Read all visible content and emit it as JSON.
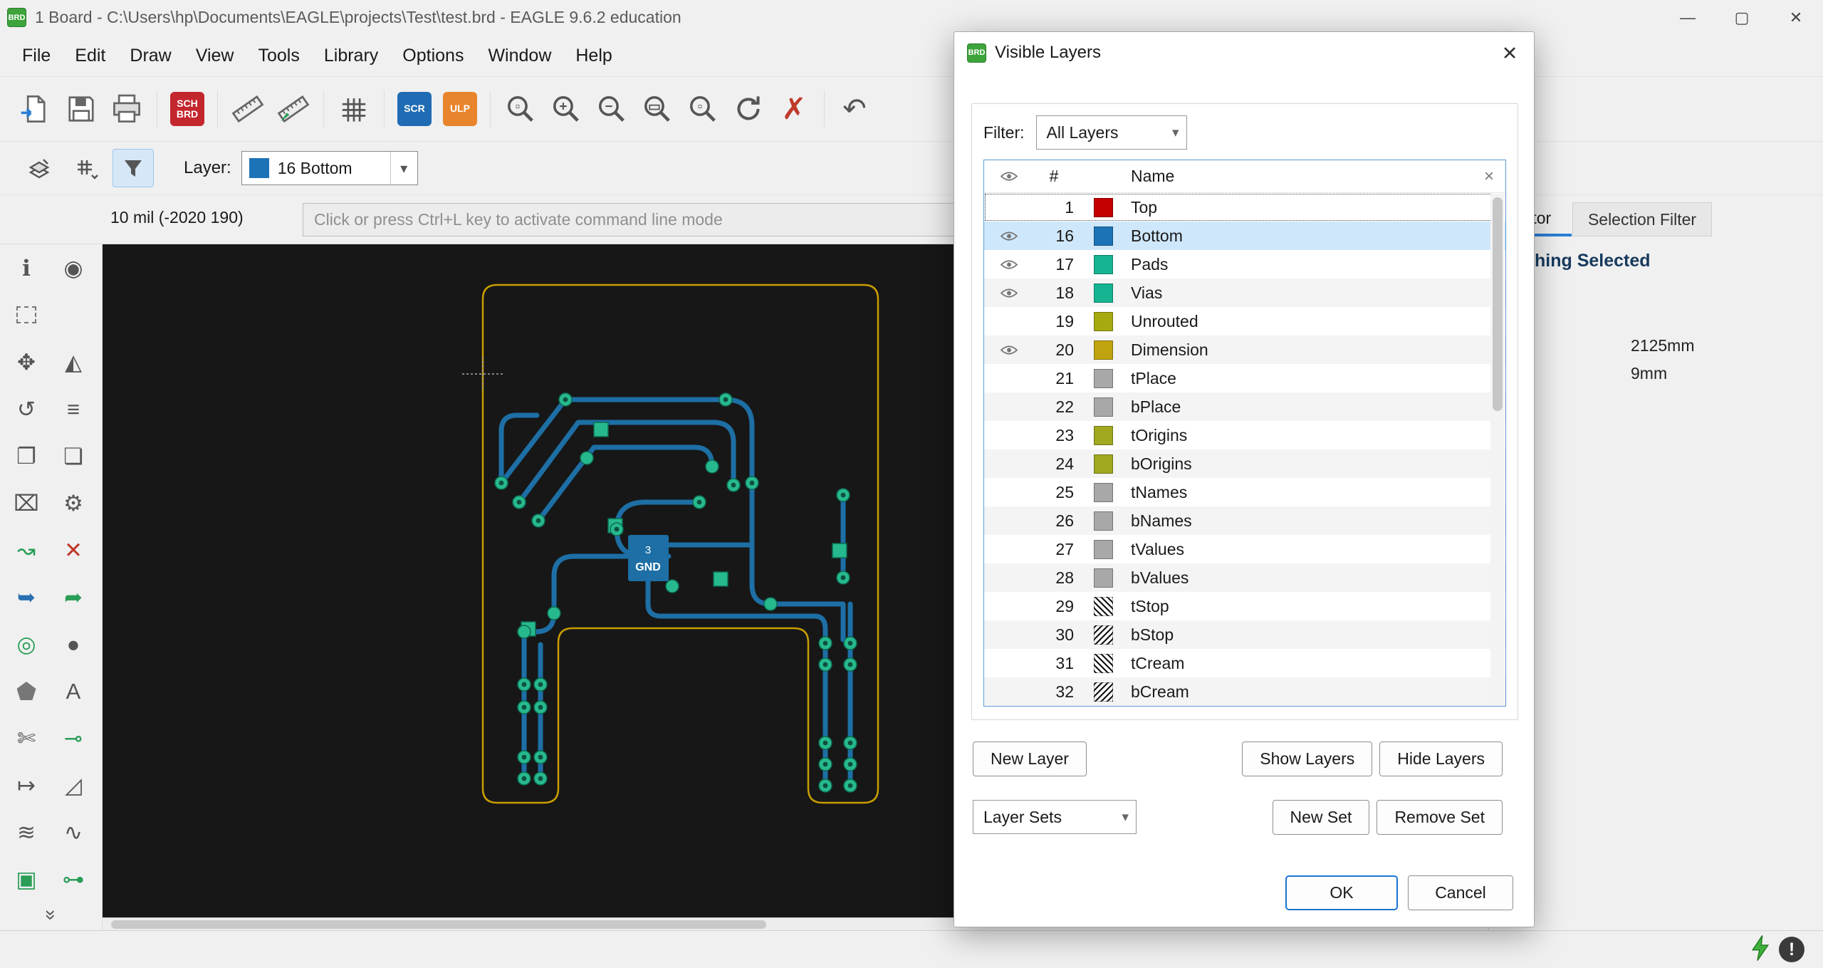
{
  "colors": {
    "accent": "#1976d2",
    "selection": "#cfe7fa",
    "canvas_bg": "#171717",
    "board_outline": "#c89e00",
    "trace": "#1d6fa5",
    "pad": "#27b98e"
  },
  "window": {
    "icon_label": "BRD",
    "title": "1 Board - C:\\Users\\hp\\Documents\\EAGLE\\projects\\Test\\test.brd - EAGLE 9.6.2 education",
    "controls": {
      "minimize": "—",
      "maximize": "▢",
      "close": "✕"
    }
  },
  "menu_bar": {
    "items": [
      "File",
      "Edit",
      "Draw",
      "View",
      "Tools",
      "Library",
      "Options",
      "Window",
      "Help"
    ]
  },
  "toolbar": {
    "items": [
      {
        "name": "open-button",
        "kind": "svg",
        "svg": "open"
      },
      {
        "name": "save-button",
        "kind": "svg",
        "svg": "save"
      },
      {
        "name": "print-button",
        "kind": "svg",
        "svg": "print"
      },
      {
        "kind": "sep"
      },
      {
        "name": "schematic-board-toggle-button",
        "kind": "badge",
        "bg": "#c4262e",
        "lines": [
          "SCH",
          "BRD"
        ]
      },
      {
        "kind": "sep"
      },
      {
        "name": "measure-ruler-button",
        "kind": "svg",
        "svg": "ruler"
      },
      {
        "name": "measure-import-ruler-button",
        "kind": "svg",
        "svg": "ruler2"
      },
      {
        "kind": "sep"
      },
      {
        "name": "grid-button",
        "kind": "svg",
        "svg": "grid"
      },
      {
        "kind": "sep"
      },
      {
        "name": "script-button",
        "kind": "badge",
        "bg": "#1f6cb4",
        "lines": [
          "SCR"
        ]
      },
      {
        "name": "ulp-button",
        "kind": "badge",
        "bg": "#e8842c",
        "lines": [
          "ULP"
        ]
      },
      {
        "kind": "sep"
      },
      {
        "name": "zoom-select-button",
        "kind": "mag",
        "sub": "▫"
      },
      {
        "name": "zoom-in-button",
        "kind": "mag",
        "sub": "+"
      },
      {
        "name": "zoom-out-button",
        "kind": "mag",
        "sub": "−"
      },
      {
        "name": "zoom-fit-button",
        "kind": "mag",
        "sub": "▭"
      },
      {
        "name": "zoom-redraw-button",
        "kind": "mag",
        "sub": "▫"
      },
      {
        "name": "refresh-button",
        "kind": "svg",
        "svg": "refresh"
      },
      {
        "name": "delete-tool-button",
        "kind": "glyph",
        "glyph": "✗",
        "color": "#c0392b",
        "size": 42
      },
      {
        "kind": "sep"
      },
      {
        "name": "undo-button",
        "kind": "glyph",
        "glyph": "↶",
        "color": "#555",
        "size": 40
      }
    ]
  },
  "layer_bar": {
    "label": "Layer:",
    "selected_layer": {
      "number": 16,
      "display": "16 Bottom",
      "color": "#1c74b6"
    },
    "arrow": "▾"
  },
  "command_bar": {
    "coordinates": "10 mil (-2020 190)",
    "placeholder": "Click or press Ctrl+L key to activate command line mode"
  },
  "sidebar": {
    "rows": [
      [
        {
          "name": "info-icon",
          "glyph": "ℹ"
        },
        {
          "name": "eye-icon",
          "glyph": "◉"
        }
      ],
      [
        {
          "name": "select-marquee-icon",
          "cls": "dashed"
        }
      ],
      [
        {
          "name": "move-icon",
          "glyph": "✥"
        },
        {
          "name": "mirror-icon",
          "glyph": "◭"
        }
      ],
      [
        {
          "name": "rotate-icon",
          "glyph": "↺"
        },
        {
          "name": "align-icon",
          "glyph": "≡"
        }
      ],
      [
        {
          "name": "copy-icon",
          "glyph": "❐"
        },
        {
          "name": "paste-icon",
          "glyph": "❏"
        }
      ],
      [
        {
          "name": "delete-icon",
          "glyph": "⌧"
        },
        {
          "name": "wrench-icon",
          "glyph": "⚙"
        }
      ],
      [
        {
          "name": "route-icon",
          "glyph": "↝",
          "color": "#2a9d57"
        },
        {
          "name": "ripup-icon",
          "glyph": "✕",
          "color": "#c0392b"
        }
      ],
      [
        {
          "name": "bend-left-icon",
          "glyph": "➥",
          "color": "#2a6fb0"
        },
        {
          "name": "bend-right-icon",
          "glyph": "➦",
          "color": "#2a9d57"
        }
      ],
      [
        {
          "name": "via-icon",
          "glyph": "◎",
          "color": "#2a9d57"
        },
        {
          "name": "circle-icon",
          "glyph": "●"
        }
      ],
      [
        {
          "name": "polygon-icon",
          "cls": "pentagon"
        },
        {
          "name": "text-icon",
          "glyph": "A"
        }
      ],
      [
        {
          "name": "split-icon",
          "glyph": "✄"
        },
        {
          "name": "miter-icon",
          "glyph": "⊸",
          "color": "#2a9d57"
        }
      ],
      [
        {
          "name": "dimension-icon",
          "glyph": "↦"
        },
        {
          "name": "measure-icon",
          "glyph": "◿"
        }
      ],
      [
        {
          "name": "signal-icon",
          "glyph": "≋"
        },
        {
          "name": "meander-icon",
          "glyph": "∿"
        }
      ],
      [
        {
          "name": "package-3d-icon",
          "glyph": "▣",
          "color": "#2a9d57"
        },
        {
          "name": "pin-icon",
          "glyph": "⊶",
          "color": "#2a9d57"
        }
      ]
    ],
    "collapse_glyph": "»"
  },
  "canvas": {
    "component": {
      "pin": "3",
      "label": "GND"
    }
  },
  "right_panel": {
    "tabs": [
      {
        "label": "ctor",
        "active": true
      },
      {
        "label": "Selection Filter",
        "active": false
      }
    ],
    "heading": "hing Selected",
    "values": [
      "2125mm",
      "9mm"
    ]
  },
  "dialog": {
    "icon_label": "BRD",
    "title": "Visible Layers",
    "close_glyph": "✕",
    "filter": {
      "label": "Filter:",
      "value": "All Layers",
      "arrow": "▾"
    },
    "table": {
      "columns": {
        "number": "#",
        "name": "Name",
        "delete": "×"
      }
    },
    "layers": [
      {
        "number": 1,
        "name": "Top",
        "color": "#c40000",
        "visible": false,
        "selected": false,
        "focused": true
      },
      {
        "number": 16,
        "name": "Bottom",
        "color": "#1c74b6",
        "visible": true,
        "selected": true
      },
      {
        "number": 17,
        "name": "Pads",
        "color": "#17b491",
        "visible": true
      },
      {
        "number": 18,
        "name": "Vias",
        "color": "#17b491",
        "visible": true
      },
      {
        "number": 19,
        "name": "Unrouted",
        "color": "#a6a90f",
        "visible": false
      },
      {
        "number": 20,
        "name": "Dimension",
        "color": "#bfa30f",
        "visible": true
      },
      {
        "number": 21,
        "name": "tPlace",
        "color": "#a8a8a8",
        "visible": false
      },
      {
        "number": 22,
        "name": "bPlace",
        "color": "#a8a8a8",
        "visible": false
      },
      {
        "number": 23,
        "name": "tOrigins",
        "color": "#9fa81f",
        "visible": false
      },
      {
        "number": 24,
        "name": "bOrigins",
        "color": "#9fa81f",
        "visible": false
      },
      {
        "number": 25,
        "name": "tNames",
        "color": "#a8a8a8",
        "visible": false
      },
      {
        "number": 26,
        "name": "bNames",
        "color": "#a8a8a8",
        "visible": false
      },
      {
        "number": 27,
        "name": "tValues",
        "color": "#a8a8a8",
        "visible": false
      },
      {
        "number": 28,
        "name": "bValues",
        "color": "#a8a8a8",
        "visible": false
      },
      {
        "number": 29,
        "name": "tStop",
        "hatch": "/",
        "visible": false
      },
      {
        "number": 30,
        "name": "bStop",
        "hatch": "\\",
        "visible": false
      },
      {
        "number": 31,
        "name": "tCream",
        "hatch": "/",
        "visible": false
      },
      {
        "number": 32,
        "name": "bCream",
        "hatch": "\\",
        "visible": false
      }
    ],
    "buttons": {
      "new_layer": "New Layer",
      "show_layers": "Show Layers",
      "hide_layers": "Hide Layers",
      "new_set": "New Set",
      "remove_set": "Remove Set",
      "ok": "OK",
      "cancel": "Cancel"
    },
    "layer_sets": {
      "value": "Layer Sets",
      "arrow": "▾"
    }
  },
  "status_bar": {
    "alert_glyph": "!"
  }
}
